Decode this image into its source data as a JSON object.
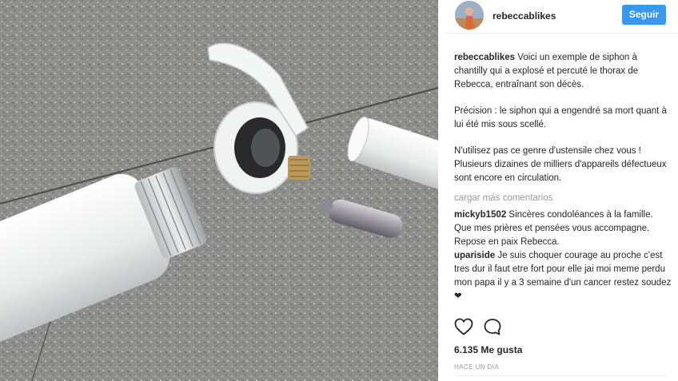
{
  "header": {
    "username": "rebeccablikes",
    "follow_label": "Seguir"
  },
  "caption": {
    "username": "rebeccablikes",
    "paragraphs": [
      "Voici un exemple de siphon à chantilly qui a explosé et percuté le thorax de Rebecca, entraînant son décès.",
      "Précision : le siphon qui a engendré sa mort quant à lui été mis sous scellé.",
      "N'utilisez pas ce genre d'ustensile chez vous ! Plusieurs dizaines de milliers d'appareils défectueux sont encore en circulation."
    ]
  },
  "load_more": "cargar más comentarios",
  "comments": [
    {
      "username": "mickyb1502",
      "text": "Sincères condoléances à la famille. Que mes prières et pensées vous accompagne. Repose en paix Rebecca."
    },
    {
      "username": "upariside",
      "text": "Je suis choquer courage au proche c'est tres dur il faut etre fort pour elle jai moi meme perdu mon papa il y a 3 semaine d'un cancer restez soudez ❤"
    }
  ],
  "icons": {
    "like": "heart-icon",
    "comment": "comment-icon"
  },
  "likes": "6.135 Me gusta",
  "timestamp": "HACE UN DÍA",
  "colors": {
    "follow_button": "#3897f0",
    "muted_text": "#999999"
  }
}
